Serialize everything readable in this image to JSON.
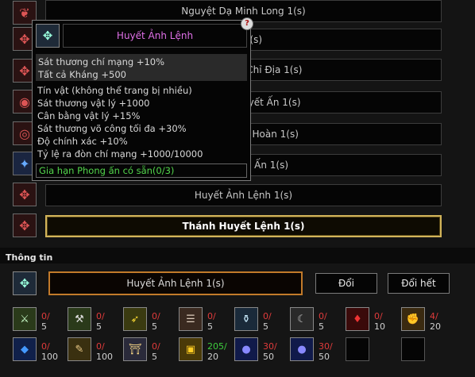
{
  "rows": [
    {
      "label": "Nguyệt Dạ Minh Long 1(s)",
      "icon": "dragon-icon"
    },
    {
      "label": "Địa 1(s)",
      "icon": "red-token-icon"
    },
    {
      "label": "Diêm Vương Chỉ Địa 1(s)",
      "icon": "red-token-icon"
    },
    {
      "label": "Bá Vương Huyết Ấn 1(s)",
      "icon": "red-seal-icon"
    },
    {
      "label": "Bá Vương Kỳ Hoàn 1(s)",
      "icon": "red-ring-icon"
    },
    {
      "label": "Phi Long Ái Ấn 1(s)",
      "icon": "blue-seal-icon"
    },
    {
      "label": "Huyết Ảnh Lệnh 1(s)",
      "icon": "red-token-icon"
    },
    {
      "label": "Thánh Huyết Lệnh 1(s)",
      "icon": "red-token-icon",
      "selected": true
    }
  ],
  "tooltip": {
    "title": "Huyết Ảnh Lệnh",
    "box_lines": [
      "Sát thương chí mạng +10%",
      "Tất cả Kháng +500"
    ],
    "lines": [
      "Tín vật (không thể trang bị nhiều)",
      "Sát thương vật lý +1000",
      "Cân bằng vật lý +15%",
      "Sát thương võ công tối đa +30%",
      "Độ chính xác +10%",
      "Tỷ lệ ra đòn chí mạng +1000/10000"
    ],
    "extend": "Gia hạn Phong ấn có sẵn(0/3)",
    "close_label": "?"
  },
  "info": {
    "title": "Thông tin",
    "item_name": "Huyết Ảnh Lệnh 1(s)",
    "exchange_button": "Đổi",
    "exchange_all_button": "Đổi hết"
  },
  "materials": [
    {
      "icon": "sword-icon",
      "have": "0/",
      "need": "5",
      "ok": false
    },
    {
      "icon": "axe-icon",
      "have": "0/",
      "need": "5",
      "ok": false
    },
    {
      "icon": "bow-icon",
      "have": "0/",
      "need": "5",
      "ok": false
    },
    {
      "icon": "scroll-icon",
      "have": "0/",
      "need": "5",
      "ok": false
    },
    {
      "icon": "vase-icon",
      "have": "0/",
      "need": "5",
      "ok": false
    },
    {
      "icon": "claw-icon",
      "have": "0/",
      "need": "5",
      "ok": false
    },
    {
      "icon": "blood-drop-icon",
      "have": "0/",
      "need": "10",
      "ok": false
    },
    {
      "icon": "fist-icon",
      "have": "4/",
      "need": "20",
      "ok": false
    },
    {
      "icon": "blue-gem-icon",
      "have": "0/",
      "need": "100",
      "ok": false
    },
    {
      "icon": "brush-icon",
      "have": "0/",
      "need": "100",
      "ok": false
    },
    {
      "icon": "gate-icon",
      "have": "0/",
      "need": "5",
      "ok": false
    },
    {
      "icon": "gold-box-icon",
      "have": "205/",
      "need": "20",
      "ok": true
    },
    {
      "icon": "blue-orb-icon",
      "have": "30/",
      "need": "50",
      "ok": false
    },
    {
      "icon": "blue-orb-icon",
      "have": "30/",
      "need": "50",
      "ok": false
    },
    {
      "icon": "empty-slot-icon",
      "have": "",
      "need": "",
      "ok": false,
      "empty": true
    },
    {
      "icon": "empty-slot-icon",
      "have": "",
      "need": "",
      "ok": false,
      "empty": true
    }
  ]
}
